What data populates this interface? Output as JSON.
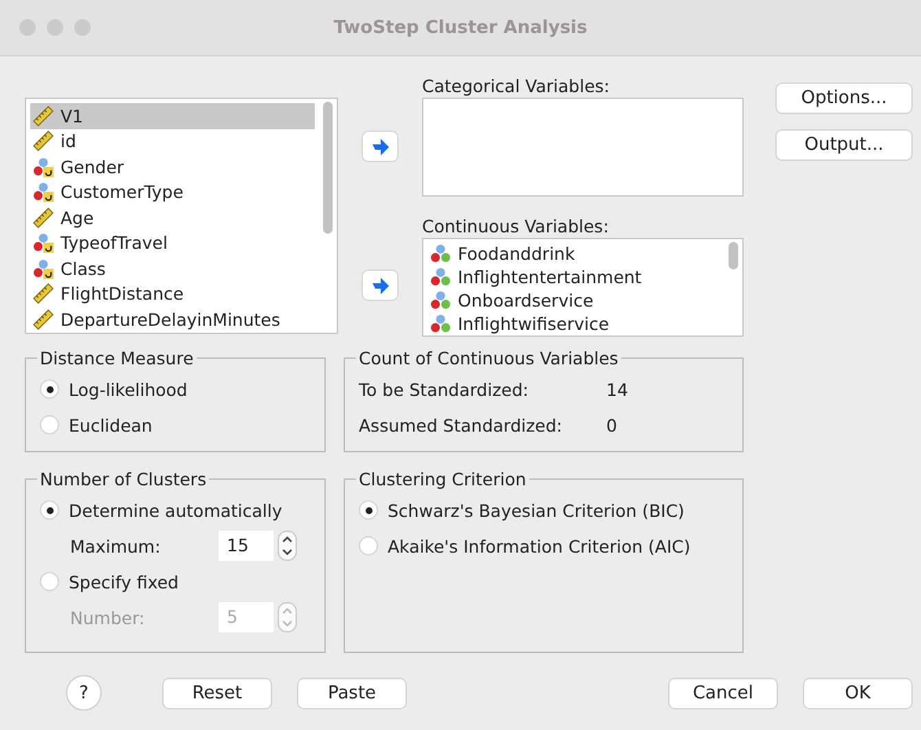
{
  "window": {
    "title": "TwoStep Cluster Analysis"
  },
  "source_list": {
    "items": [
      {
        "label": "V1",
        "kind": "scale",
        "selected": true
      },
      {
        "label": "id",
        "kind": "scale",
        "selected": false
      },
      {
        "label": "Gender",
        "kind": "nominal",
        "selected": false
      },
      {
        "label": "CustomerType",
        "kind": "nominal",
        "selected": false
      },
      {
        "label": "Age",
        "kind": "scale",
        "selected": false
      },
      {
        "label": "TypeofTravel",
        "kind": "nominal",
        "selected": false
      },
      {
        "label": "Class",
        "kind": "nominal",
        "selected": false
      },
      {
        "label": "FlightDistance",
        "kind": "scale",
        "selected": false
      },
      {
        "label": "DepartureDelayinMinutes",
        "kind": "scale",
        "selected": false
      }
    ]
  },
  "categorical": {
    "label": "Categorical Variables:"
  },
  "continuous": {
    "label": "Continuous Variables:",
    "items": [
      {
        "label": "Foodanddrink",
        "kind": "ordinal",
        "selected": false
      },
      {
        "label": "Inflightentertainment",
        "kind": "ordinal",
        "selected": false
      },
      {
        "label": "Onboardservice",
        "kind": "ordinal",
        "selected": false
      },
      {
        "label": "Inflightwifiservice",
        "kind": "ordinal",
        "selected": false
      }
    ]
  },
  "side_buttons": [
    "Options...",
    "Output..."
  ],
  "distance_measure": {
    "title": "Distance Measure",
    "options": [
      {
        "label": "Log-likelihood",
        "selected": true
      },
      {
        "label": "Euclidean",
        "selected": false
      }
    ]
  },
  "count": {
    "title": "Count of Continuous Variables",
    "rows": [
      {
        "label": "To be Standardized:",
        "value": "14"
      },
      {
        "label": "Assumed Standardized:",
        "value": "0"
      }
    ]
  },
  "number_of_clusters": {
    "title": "Number of Clusters",
    "options": [
      {
        "label": "Determine automatically",
        "selected": true,
        "field": {
          "label": "Maximum:",
          "value": "15",
          "disabled": false
        }
      },
      {
        "label": "Specify fixed",
        "selected": false,
        "field": {
          "label": "Number:",
          "value": "5",
          "disabled": true
        }
      }
    ]
  },
  "criterion": {
    "title": "Clustering Criterion",
    "options": [
      {
        "label": "Schwarz's Bayesian Criterion (BIC)",
        "selected": true
      },
      {
        "label": "Akaike's Information Criterion (AIC)",
        "selected": false
      }
    ]
  },
  "bottom_buttons": {
    "help": "?",
    "left": [
      "Reset",
      "Paste"
    ],
    "right": [
      "Cancel",
      "OK"
    ]
  }
}
